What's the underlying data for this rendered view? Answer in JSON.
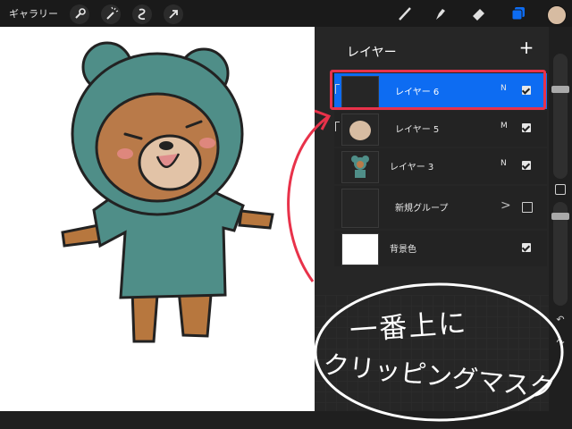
{
  "toolbar": {
    "gallery_label": "ギャラリー",
    "left_tools": [
      "wrench-icon",
      "magic-wand-icon",
      "selection-icon",
      "transform-arrow-icon"
    ],
    "right_tools": [
      "brush-icon",
      "smudge-icon",
      "eraser-icon",
      "layers-icon",
      "color-icon"
    ],
    "active_tool_color": "#0d6cf2",
    "color_swatch": "#d7bca2"
  },
  "layers_panel": {
    "title": "レイヤー",
    "add_label": "+",
    "layers": [
      {
        "name": "レイヤー 6",
        "mode": "N",
        "visible": true,
        "active": true
      },
      {
        "name": "レイヤー 5",
        "mode": "M",
        "visible": true,
        "active": false
      },
      {
        "name": "レイヤー 3",
        "mode": "N",
        "visible": true,
        "active": false
      },
      {
        "name": "新規グループ",
        "mode": ">",
        "visible": false,
        "active": false
      },
      {
        "name": "背景色",
        "mode": "",
        "visible": true,
        "active": false
      }
    ]
  },
  "annotation": {
    "line1": "一番上に",
    "line2": "クリッピングマスク",
    "color": "#e8324a"
  },
  "sidebar_strip": {
    "undo_icon": "undo-icon",
    "redo_icon": "redo-icon"
  }
}
